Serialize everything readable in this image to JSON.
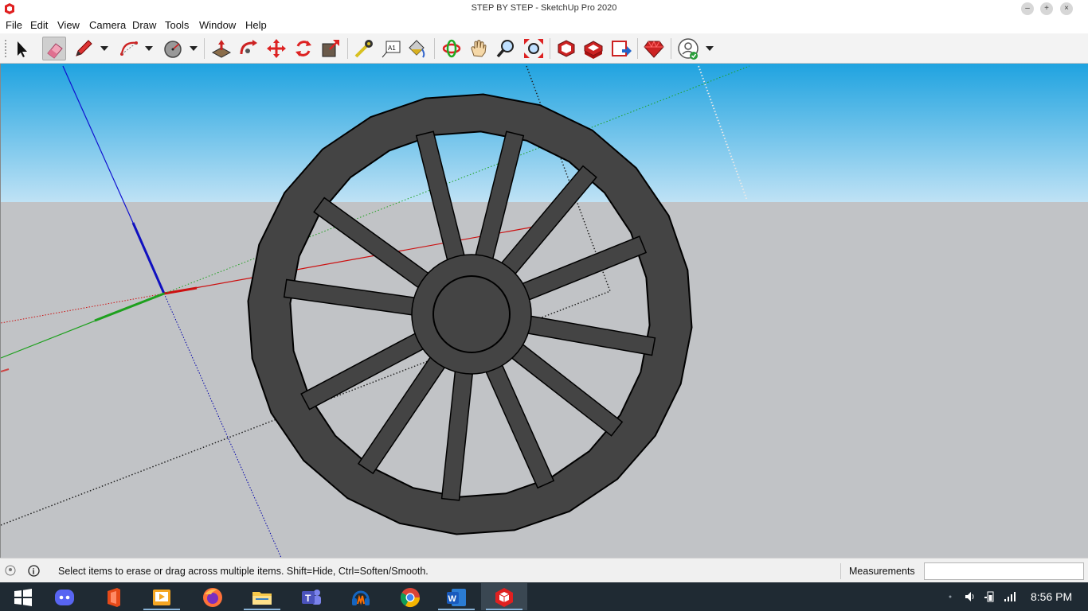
{
  "window": {
    "title": "STEP BY STEP - SketchUp Pro 2020",
    "minimize_glyph": "–",
    "maximize_glyph": "+",
    "close_glyph": "×"
  },
  "menu": {
    "items": [
      "File",
      "Edit",
      "View",
      "Camera",
      "Draw",
      "Tools",
      "Window",
      "Help"
    ]
  },
  "toolbar": {
    "tools": [
      {
        "name": "select-tool-icon",
        "active": false
      },
      {
        "name": "eraser-tool-icon",
        "active": true
      },
      {
        "name": "pencil-line-tool-icon",
        "active": false
      },
      {
        "name": "arc-tool-icon",
        "active": false
      },
      {
        "name": "shape-circle-tool-icon",
        "active": false
      },
      {
        "name": "push-pull-tool-icon",
        "active": false
      },
      {
        "name": "follow-me-tool-icon",
        "active": false
      },
      {
        "name": "move-tool-icon",
        "active": false
      },
      {
        "name": "rotate-tool-icon",
        "active": false
      },
      {
        "name": "scale-tool-icon",
        "active": false
      },
      {
        "name": "tape-measure-tool-icon",
        "active": false
      },
      {
        "name": "text-tool-icon",
        "active": false
      },
      {
        "name": "paint-bucket-tool-icon",
        "active": false
      },
      {
        "name": "orbit-tool-icon",
        "active": false
      },
      {
        "name": "pan-tool-icon",
        "active": false
      },
      {
        "name": "zoom-tool-icon",
        "active": false
      },
      {
        "name": "zoom-extents-tool-icon",
        "active": false
      },
      {
        "name": "3d-warehouse-icon",
        "active": false
      },
      {
        "name": "extension-warehouse-icon",
        "active": false
      },
      {
        "name": "send-to-layout-icon",
        "active": false
      },
      {
        "name": "extension-manager-icon",
        "active": false
      },
      {
        "name": "account-icon",
        "active": false
      }
    ],
    "text_tool_glyph": "A1"
  },
  "status": {
    "message": "Select items to erase or drag across multiple items. Shift=Hide, Ctrl=Soften/Smooth.",
    "measurements_label": "Measurements",
    "measurements_value": "",
    "info_glyph": "i"
  },
  "taskbar": {
    "apps": [
      {
        "name": "start-button-icon"
      },
      {
        "name": "discord-icon"
      },
      {
        "name": "office-icon"
      },
      {
        "name": "video-player-icon"
      },
      {
        "name": "firefox-icon"
      },
      {
        "name": "file-explorer-icon"
      },
      {
        "name": "teams-icon"
      },
      {
        "name": "audio-app-icon"
      },
      {
        "name": "chrome-icon"
      },
      {
        "name": "word-icon"
      },
      {
        "name": "sketchup-icon"
      }
    ],
    "teams_glyph": "T",
    "word_glyph": "W",
    "clock": "8:56 PM"
  },
  "colors": {
    "sky_top": "#1fa3e0",
    "sky_bottom": "#bfe2f5",
    "ground": "#c1c3c6",
    "wheel": "#444444",
    "axis_red": "#cc0000",
    "axis_green": "#1ea01e",
    "axis_blue": "#0000cc",
    "taskbar": "#1f2a33"
  }
}
